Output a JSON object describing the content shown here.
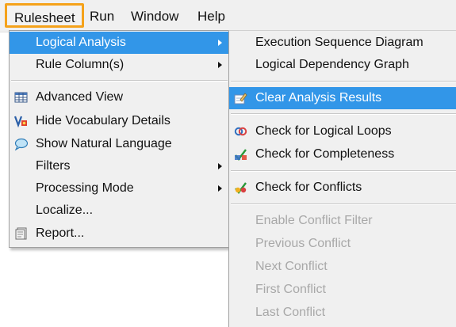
{
  "menubar": {
    "items": [
      {
        "label": "Rulesheet"
      },
      {
        "label": "Run"
      },
      {
        "label": "Window"
      },
      {
        "label": "Help"
      }
    ]
  },
  "main_menu": {
    "items": [
      {
        "label": "Logical Analysis",
        "submenu": true,
        "selected": true
      },
      {
        "label": "Rule Column(s)",
        "submenu": true
      },
      {
        "label": "Advanced View",
        "icon": "table-grid-icon"
      },
      {
        "label": "Hide Vocabulary Details",
        "icon": "vocabulary-icon"
      },
      {
        "label": "Show Natural Language",
        "icon": "speech-bubble-icon"
      },
      {
        "label": "Filters",
        "submenu": true
      },
      {
        "label": "Processing Mode",
        "submenu": true
      },
      {
        "label": "Localize..."
      },
      {
        "label": "Report...",
        "icon": "report-icon"
      }
    ]
  },
  "sub_menu": {
    "items": [
      {
        "label": "Execution Sequence Diagram"
      },
      {
        "label": "Logical Dependency Graph"
      },
      {
        "label": "Clear Analysis Results",
        "icon": "eraser-icon",
        "selected": true
      },
      {
        "label": "Check for Logical Loops",
        "icon": "loop-check-icon"
      },
      {
        "label": "Check for Completeness",
        "icon": "completeness-check-icon"
      },
      {
        "label": "Check for Conflicts",
        "icon": "conflict-check-icon"
      },
      {
        "label": "Enable Conflict Filter",
        "disabled": true
      },
      {
        "label": "Previous Conflict",
        "disabled": true
      },
      {
        "label": "Next Conflict",
        "disabled": true
      },
      {
        "label": "First Conflict",
        "disabled": true
      },
      {
        "label": "Last Conflict",
        "disabled": true
      }
    ]
  },
  "colors": {
    "highlight": "#3296e8",
    "focus_border": "#f5a21a",
    "menu_bg": "#f0f0f0",
    "disabled_text": "#a8a8a8"
  }
}
